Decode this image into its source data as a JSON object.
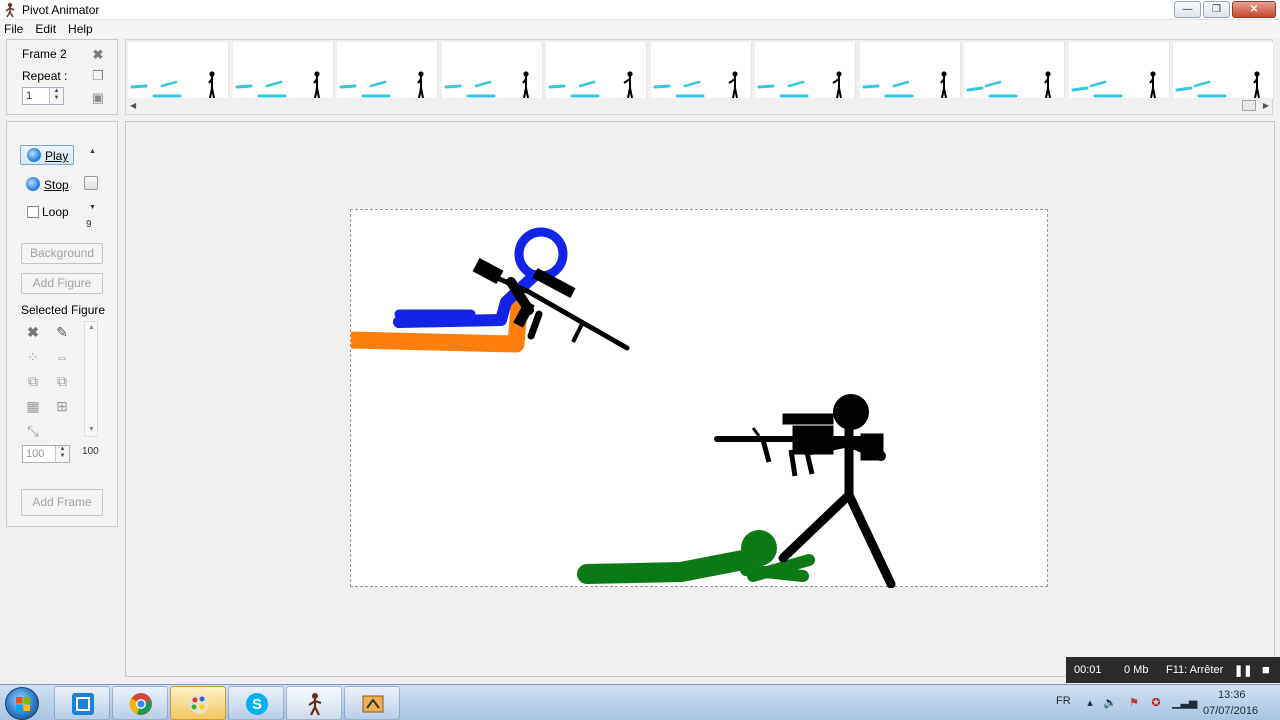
{
  "window": {
    "title": "Pivot Animator",
    "minimize": "—",
    "maximize": "❐",
    "close": "✕"
  },
  "menu": [
    "File",
    "Edit",
    "Help"
  ],
  "frame_panel": {
    "frame_label": "Frame 2",
    "repeat_label": "Repeat :",
    "repeat_value": "1"
  },
  "timeline": {
    "frame_count_visible": 11
  },
  "playback": {
    "play_label": "Play",
    "stop_label": "Stop",
    "loop_label": "Loop",
    "speed_value": "9"
  },
  "buttons": {
    "background": "Background",
    "add_figure": "Add Figure",
    "add_frame": "Add Frame"
  },
  "selected_figure": {
    "label": "Selected Figure",
    "scale_value": "100",
    "scale_max": "100"
  },
  "recording": {
    "time": "00:01",
    "size": "0 Mb",
    "hint": "F11: Arrêter"
  },
  "taskbar": {
    "apps": [
      "screen-recorder",
      "chrome",
      "paint",
      "skype",
      "pivot-animator",
      "pivot-editor"
    ],
    "language": "FR",
    "time": "13:36",
    "date": "07/07/2016"
  },
  "colors": {
    "blue_figure": "#1424e6",
    "orange_figure": "#ff7f0e",
    "green_figure": "#0b7a16",
    "black_figure": "#000000",
    "thumb_figure": "#33c7e0"
  }
}
